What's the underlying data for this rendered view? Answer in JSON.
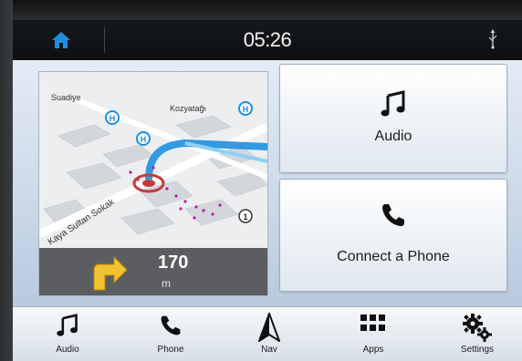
{
  "statusbar": {
    "time": "05:26",
    "home_icon": "home-icon",
    "usb_icon": "usb-icon"
  },
  "map": {
    "labels": [
      "Suadiye",
      "Kozyatağı",
      "Kaya Sultan Sokak"
    ],
    "distance_value": "170",
    "distance_unit": "m",
    "turn_icon": "turn-right-arrow-icon"
  },
  "tiles": {
    "audio": {
      "label": "Audio",
      "icon": "music-note-icon"
    },
    "phone": {
      "label": "Connect a Phone",
      "icon": "phone-icon"
    }
  },
  "bottom_nav": [
    {
      "label": "Audio",
      "icon": "music-note-icon"
    },
    {
      "label": "Phone",
      "icon": "phone-icon"
    },
    {
      "label": "Nav",
      "icon": "nav-arrow-icon"
    },
    {
      "label": "Apps",
      "icon": "apps-grid-icon"
    },
    {
      "label": "Settings",
      "icon": "gears-icon"
    }
  ],
  "colors": {
    "accent_blue": "#1e8fe0",
    "turn_arrow": "#f2c230",
    "map_panel": "#5b5d60"
  }
}
